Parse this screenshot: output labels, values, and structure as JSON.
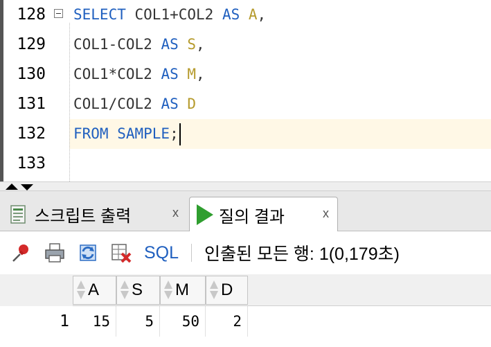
{
  "editor": {
    "lines": [
      {
        "num": "128",
        "tokens": [
          [
            "kw",
            "SELECT "
          ],
          [
            "id",
            "COL1+COL2 "
          ],
          [
            "kw",
            "AS "
          ],
          [
            "al",
            "A"
          ],
          [
            "id",
            ","
          ]
        ],
        "fold": true
      },
      {
        "num": "129",
        "tokens": [
          [
            "id",
            "COL1-COL2 "
          ],
          [
            "kw",
            "AS "
          ],
          [
            "al",
            "S"
          ],
          [
            "id",
            ","
          ]
        ]
      },
      {
        "num": "130",
        "tokens": [
          [
            "id",
            "COL1*COL2 "
          ],
          [
            "kw",
            "AS "
          ],
          [
            "al",
            "M"
          ],
          [
            "id",
            ","
          ]
        ]
      },
      {
        "num": "131",
        "tokens": [
          [
            "id",
            "COL1/COL2 "
          ],
          [
            "kw",
            "AS "
          ],
          [
            "al",
            "D"
          ]
        ]
      },
      {
        "num": "132",
        "tokens": [
          [
            "kw",
            "FROM "
          ],
          [
            "kw",
            "SAMPLE"
          ],
          [
            "id",
            ";"
          ]
        ],
        "current": true
      },
      {
        "num": "133",
        "tokens": []
      }
    ]
  },
  "tabs": [
    {
      "label": "스크립트 출력",
      "close": "x",
      "icon": "script-output-icon"
    },
    {
      "label": "질의 결과",
      "close": "x",
      "icon": "play-icon",
      "active": true
    }
  ],
  "toolbar": {
    "sql_label": "SQL",
    "separator": "|",
    "status": "인출된 모든 행: 1(0,179초)"
  },
  "grid": {
    "columns": [
      "A",
      "S",
      "M",
      "D"
    ],
    "rows": [
      {
        "num": "1",
        "values": [
          "15",
          "5",
          "50",
          "2"
        ]
      }
    ]
  },
  "colors": {
    "keyword": "#1f5fbf",
    "alias": "#b59a2b",
    "current_line": "#fff8e6",
    "run_green": "#2f9e2f"
  }
}
